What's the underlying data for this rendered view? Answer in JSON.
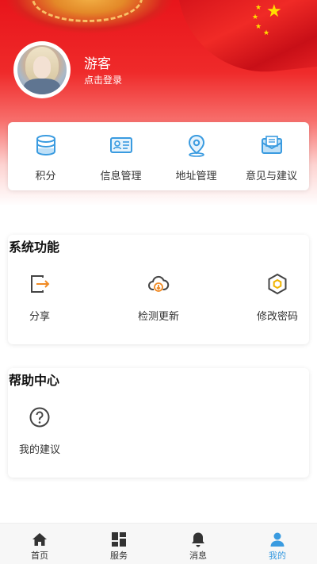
{
  "profile": {
    "username": "游客",
    "login_link": "点击登录"
  },
  "quick_actions": [
    {
      "label": "积分",
      "icon": "database-icon"
    },
    {
      "label": "信息管理",
      "icon": "id-card-icon"
    },
    {
      "label": "地址管理",
      "icon": "location-pin-icon"
    },
    {
      "label": "意见与建议",
      "icon": "mail-icon"
    }
  ],
  "system_functions": {
    "title": "系统功能",
    "items": [
      {
        "label": "分享",
        "icon": "share-exit-icon"
      },
      {
        "label": "检测更新",
        "icon": "cloud-download-icon"
      },
      {
        "label": "修改密码",
        "icon": "hexagon-nut-icon"
      }
    ]
  },
  "help_center": {
    "title": "帮助中心",
    "items": [
      {
        "label": "我的建议",
        "icon": "question-circle-icon"
      }
    ]
  },
  "tabbar": {
    "items": [
      {
        "label": "首页",
        "icon": "home-icon"
      },
      {
        "label": "服务",
        "icon": "grid-icon"
      },
      {
        "label": "消息",
        "icon": "bell-icon"
      },
      {
        "label": "我的",
        "icon": "person-icon"
      }
    ],
    "active_index": 3
  },
  "colors": {
    "header_red": "#e8151b",
    "icon_blue": "#3a9be0",
    "accent_orange": "#f08a24",
    "active_tab": "#3a9be0"
  }
}
